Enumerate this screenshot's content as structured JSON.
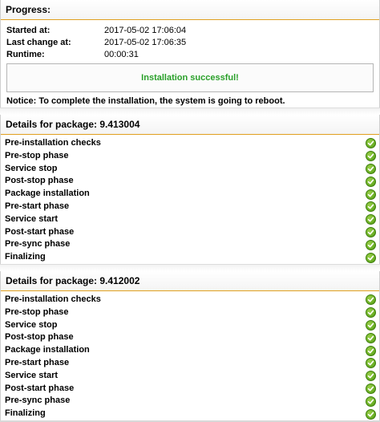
{
  "progress": {
    "title": "Progress:",
    "started_label": "Started at:",
    "started_value": "2017-05-02 17:06:04",
    "changed_label": "Last change at:",
    "changed_value": "2017-05-02 17:06:35",
    "runtime_label": "Runtime:",
    "runtime_value": "00:00:31",
    "result": "Installation successful!",
    "notice": "Notice: To complete the installation, the system is going to reboot."
  },
  "packages": [
    {
      "title": "Details for package: 9.413004",
      "steps": [
        {
          "label": "Pre-installation checks",
          "status": "check-icon"
        },
        {
          "label": "Pre-stop phase",
          "status": "check-icon"
        },
        {
          "label": "Service stop",
          "status": "check-icon"
        },
        {
          "label": "Post-stop phase",
          "status": "check-icon"
        },
        {
          "label": "Package installation",
          "status": "check-icon"
        },
        {
          "label": "Pre-start phase",
          "status": "check-icon"
        },
        {
          "label": "Service start",
          "status": "check-icon"
        },
        {
          "label": "Post-start phase",
          "status": "check-icon"
        },
        {
          "label": "Pre-sync phase",
          "status": "check-icon"
        },
        {
          "label": "Finalizing",
          "status": "check-icon"
        }
      ]
    },
    {
      "title": "Details for package: 9.412002",
      "steps": [
        {
          "label": "Pre-installation checks",
          "status": "check-icon"
        },
        {
          "label": "Pre-stop phase",
          "status": "check-icon"
        },
        {
          "label": "Service stop",
          "status": "check-icon"
        },
        {
          "label": "Post-stop phase",
          "status": "check-icon"
        },
        {
          "label": "Package installation",
          "status": "check-icon"
        },
        {
          "label": "Pre-start phase",
          "status": "check-icon"
        },
        {
          "label": "Service start",
          "status": "check-icon"
        },
        {
          "label": "Post-start phase",
          "status": "check-icon"
        },
        {
          "label": "Pre-sync phase",
          "status": "check-icon"
        },
        {
          "label": "Finalizing",
          "status": "check-icon"
        }
      ]
    }
  ],
  "colors": {
    "accent_line": "#e0a020",
    "success_text": "#2aa02a",
    "check_green": "#5aa81a"
  }
}
